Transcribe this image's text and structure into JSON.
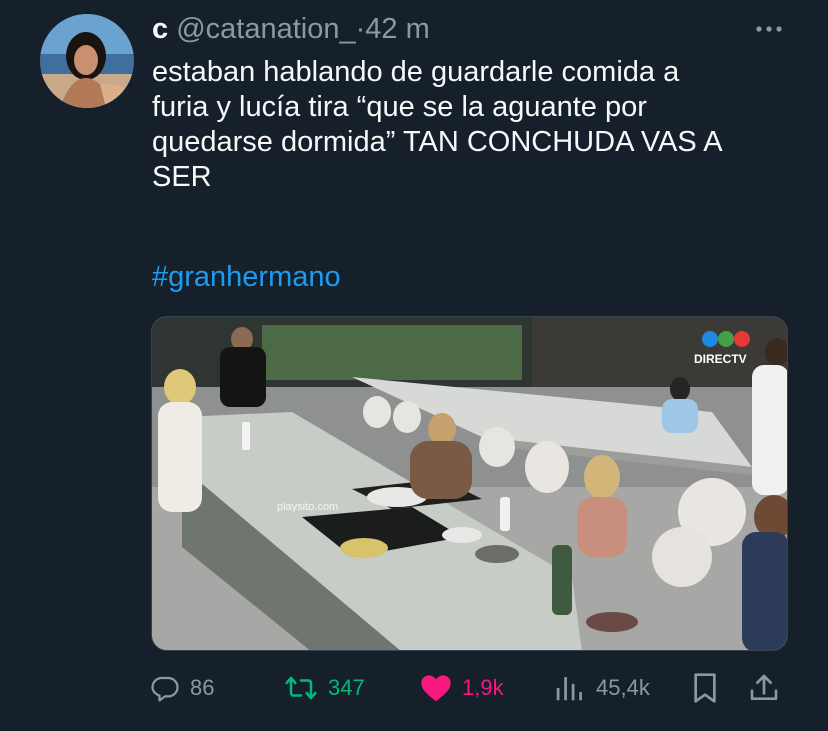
{
  "tweet": {
    "display_name": "c",
    "handle": "@catanation_",
    "separator": "·",
    "time": "42 m",
    "text_lines": [
      "estaban hablando de guardarle comida a",
      "furia y lucía tira “que se la aguante por",
      "quedarse dormida” TAN CONCHUDA VAS A",
      "SER"
    ],
    "hashtag": "#granhermano",
    "media": {
      "overlay_logo": "DIRECTV",
      "watermark": "playsito.com"
    }
  },
  "actions": {
    "replies": "86",
    "retweets": "347",
    "likes": "1,9k",
    "views": "45,4k"
  },
  "icons": {
    "more": "more-icon",
    "reply": "reply-icon",
    "retweet": "retweet-icon",
    "like": "heart-icon",
    "views": "views-icon",
    "bookmark": "bookmark-icon",
    "share": "share-icon"
  },
  "colors": {
    "background": "#15202b",
    "text": "#f7f9f9",
    "muted": "#8b98a5",
    "link": "#1d9bf0",
    "retweet": "#00ba7c",
    "like": "#f91880"
  }
}
